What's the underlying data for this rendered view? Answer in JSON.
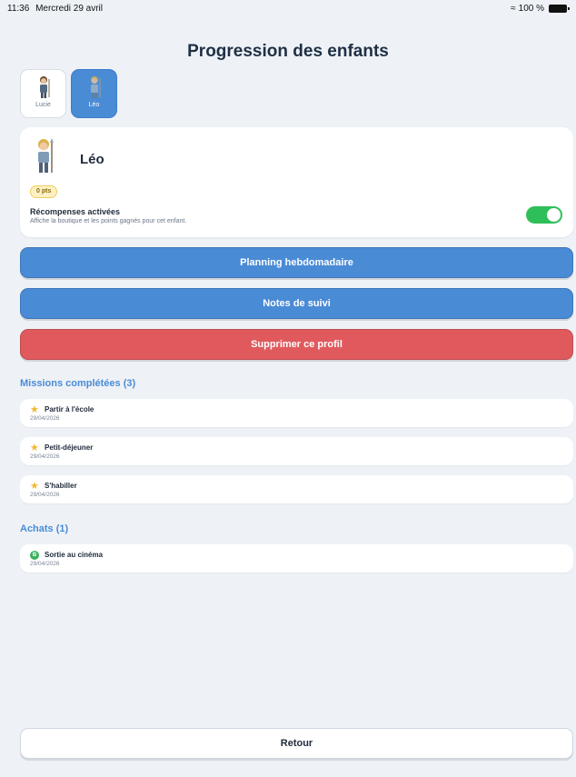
{
  "status_bar": {
    "time": "11:36",
    "date": "Mercredi 29 avril",
    "battery": "100 %"
  },
  "page": {
    "title": "Progression des enfants"
  },
  "children_tabs": [
    {
      "label": "Lucie",
      "active": false
    },
    {
      "label": "Léo",
      "active": true
    }
  ],
  "profile": {
    "name": "Léo",
    "points": "0 pts",
    "rewards_title": "Récompenses activées",
    "rewards_subtitle": "Affiche la boutique et les points gagnés pour cet enfant.",
    "rewards_enabled": true
  },
  "actions": {
    "weekly_planning": "Planning hebdomadaire",
    "follow_notes": "Notes de suivi",
    "delete_profile": "Supprimer ce profil"
  },
  "missions": {
    "title": "Missions complétées (3)",
    "items": [
      {
        "label": "Partir à l'école",
        "date": "29/04/2026",
        "icon": "star-icon"
      },
      {
        "label": "Petit-déjeuner",
        "date": "29/04/2026",
        "icon": "star-icon"
      },
      {
        "label": "S'habiller",
        "date": "29/04/2026",
        "icon": "star-icon"
      }
    ]
  },
  "purchases": {
    "title": "Achats (1)",
    "items": [
      {
        "label": "Sortie au cinéma",
        "date": "29/04/2026",
        "icon": "coin-icon"
      }
    ]
  },
  "footer": {
    "back_label": "Retour"
  },
  "colors": {
    "accent": "#4a8bd6",
    "danger": "#e05a5d",
    "toggle_on": "#2fbf5a",
    "background": "#eef2f7"
  }
}
